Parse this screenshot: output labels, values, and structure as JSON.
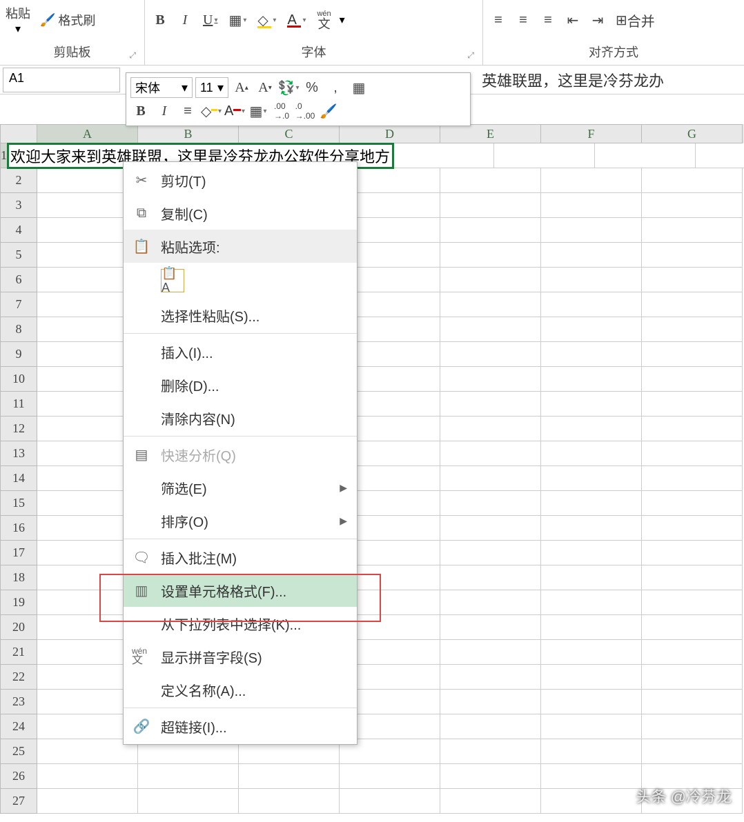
{
  "ribbon": {
    "paste_label": "粘贴",
    "format_painter": "格式刷",
    "group_clipboard": "剪贴板",
    "group_font": "字体",
    "group_align": "对齐方式",
    "wen_label": "wén",
    "wen_char": "文",
    "merge": "合并"
  },
  "namebox": {
    "ref": "A1"
  },
  "formula_overflow": "英雄联盟，这里是冷芬龙办",
  "mini": {
    "font": "宋体",
    "size": "11",
    "percent": "%",
    "comma": ","
  },
  "columns": [
    "A",
    "B",
    "C",
    "D",
    "E",
    "F",
    "G"
  ],
  "row_count": 27,
  "cell_a1": "欢迎大家来到英雄联盟，这里是冷芬龙办公软件分享地方",
  "context_menu": {
    "cut": "剪切(T)",
    "copy": "复制(C)",
    "paste_options": "粘贴选项:",
    "paste_special": "选择性粘贴(S)...",
    "insert": "插入(I)...",
    "delete": "删除(D)...",
    "clear": "清除内容(N)",
    "quick_analysis": "快速分析(Q)",
    "filter": "筛选(E)",
    "sort": "排序(O)",
    "insert_comment": "插入批注(M)",
    "format_cells": "设置单元格格式(F)...",
    "pick_list": "从下拉列表中选择(K)...",
    "show_pinyin": "显示拼音字段(S)",
    "define_name": "定义名称(A)...",
    "hyperlink": "超链接(I)..."
  },
  "watermark": "头条 @冷芬龙"
}
